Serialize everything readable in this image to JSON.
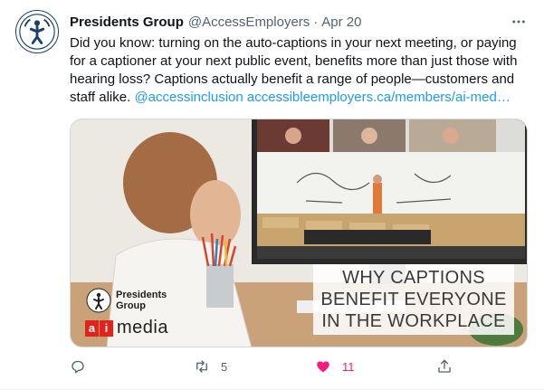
{
  "tweet": {
    "author_name": "Presidents Group",
    "handle": "@AccessEmployers",
    "separator": "·",
    "date": "Apr 20",
    "text_main": "Did you know: turning on the auto-captions in your next meeting, or paying for a captioner at your next public event, benefits more than just those with hearing loss? Captions actually benefit a range of people—customers and staff alike. ",
    "mention": "@accessinclusion",
    "url": "accessibleemployers.ca/members/ai-med…",
    "avatar_icon": "presidents-group-logo-icon",
    "more_icon": "more-horizontal-icon"
  },
  "media": {
    "title_lines": [
      "WHY CAPTIONS",
      "BENEFIT EVERYONE",
      "IN THE WORKPLACE"
    ],
    "logo_text_line1": "Presidents",
    "logo_text_line2": "Group",
    "ai_letter_a": "a",
    "ai_letter_i": "i",
    "ai_word": "media"
  },
  "actions": {
    "reply_icon": "reply-icon",
    "retweet_icon": "retweet-icon",
    "retweet_count": "5",
    "like_icon": "heart-filled-icon",
    "like_count": "11",
    "share_icon": "share-icon"
  },
  "colors": {
    "link": "#1d9bf0",
    "like": "#f91880",
    "muted": "#536471",
    "brand_navy": "#1c3f6e",
    "ai_red": "#e2231a"
  }
}
